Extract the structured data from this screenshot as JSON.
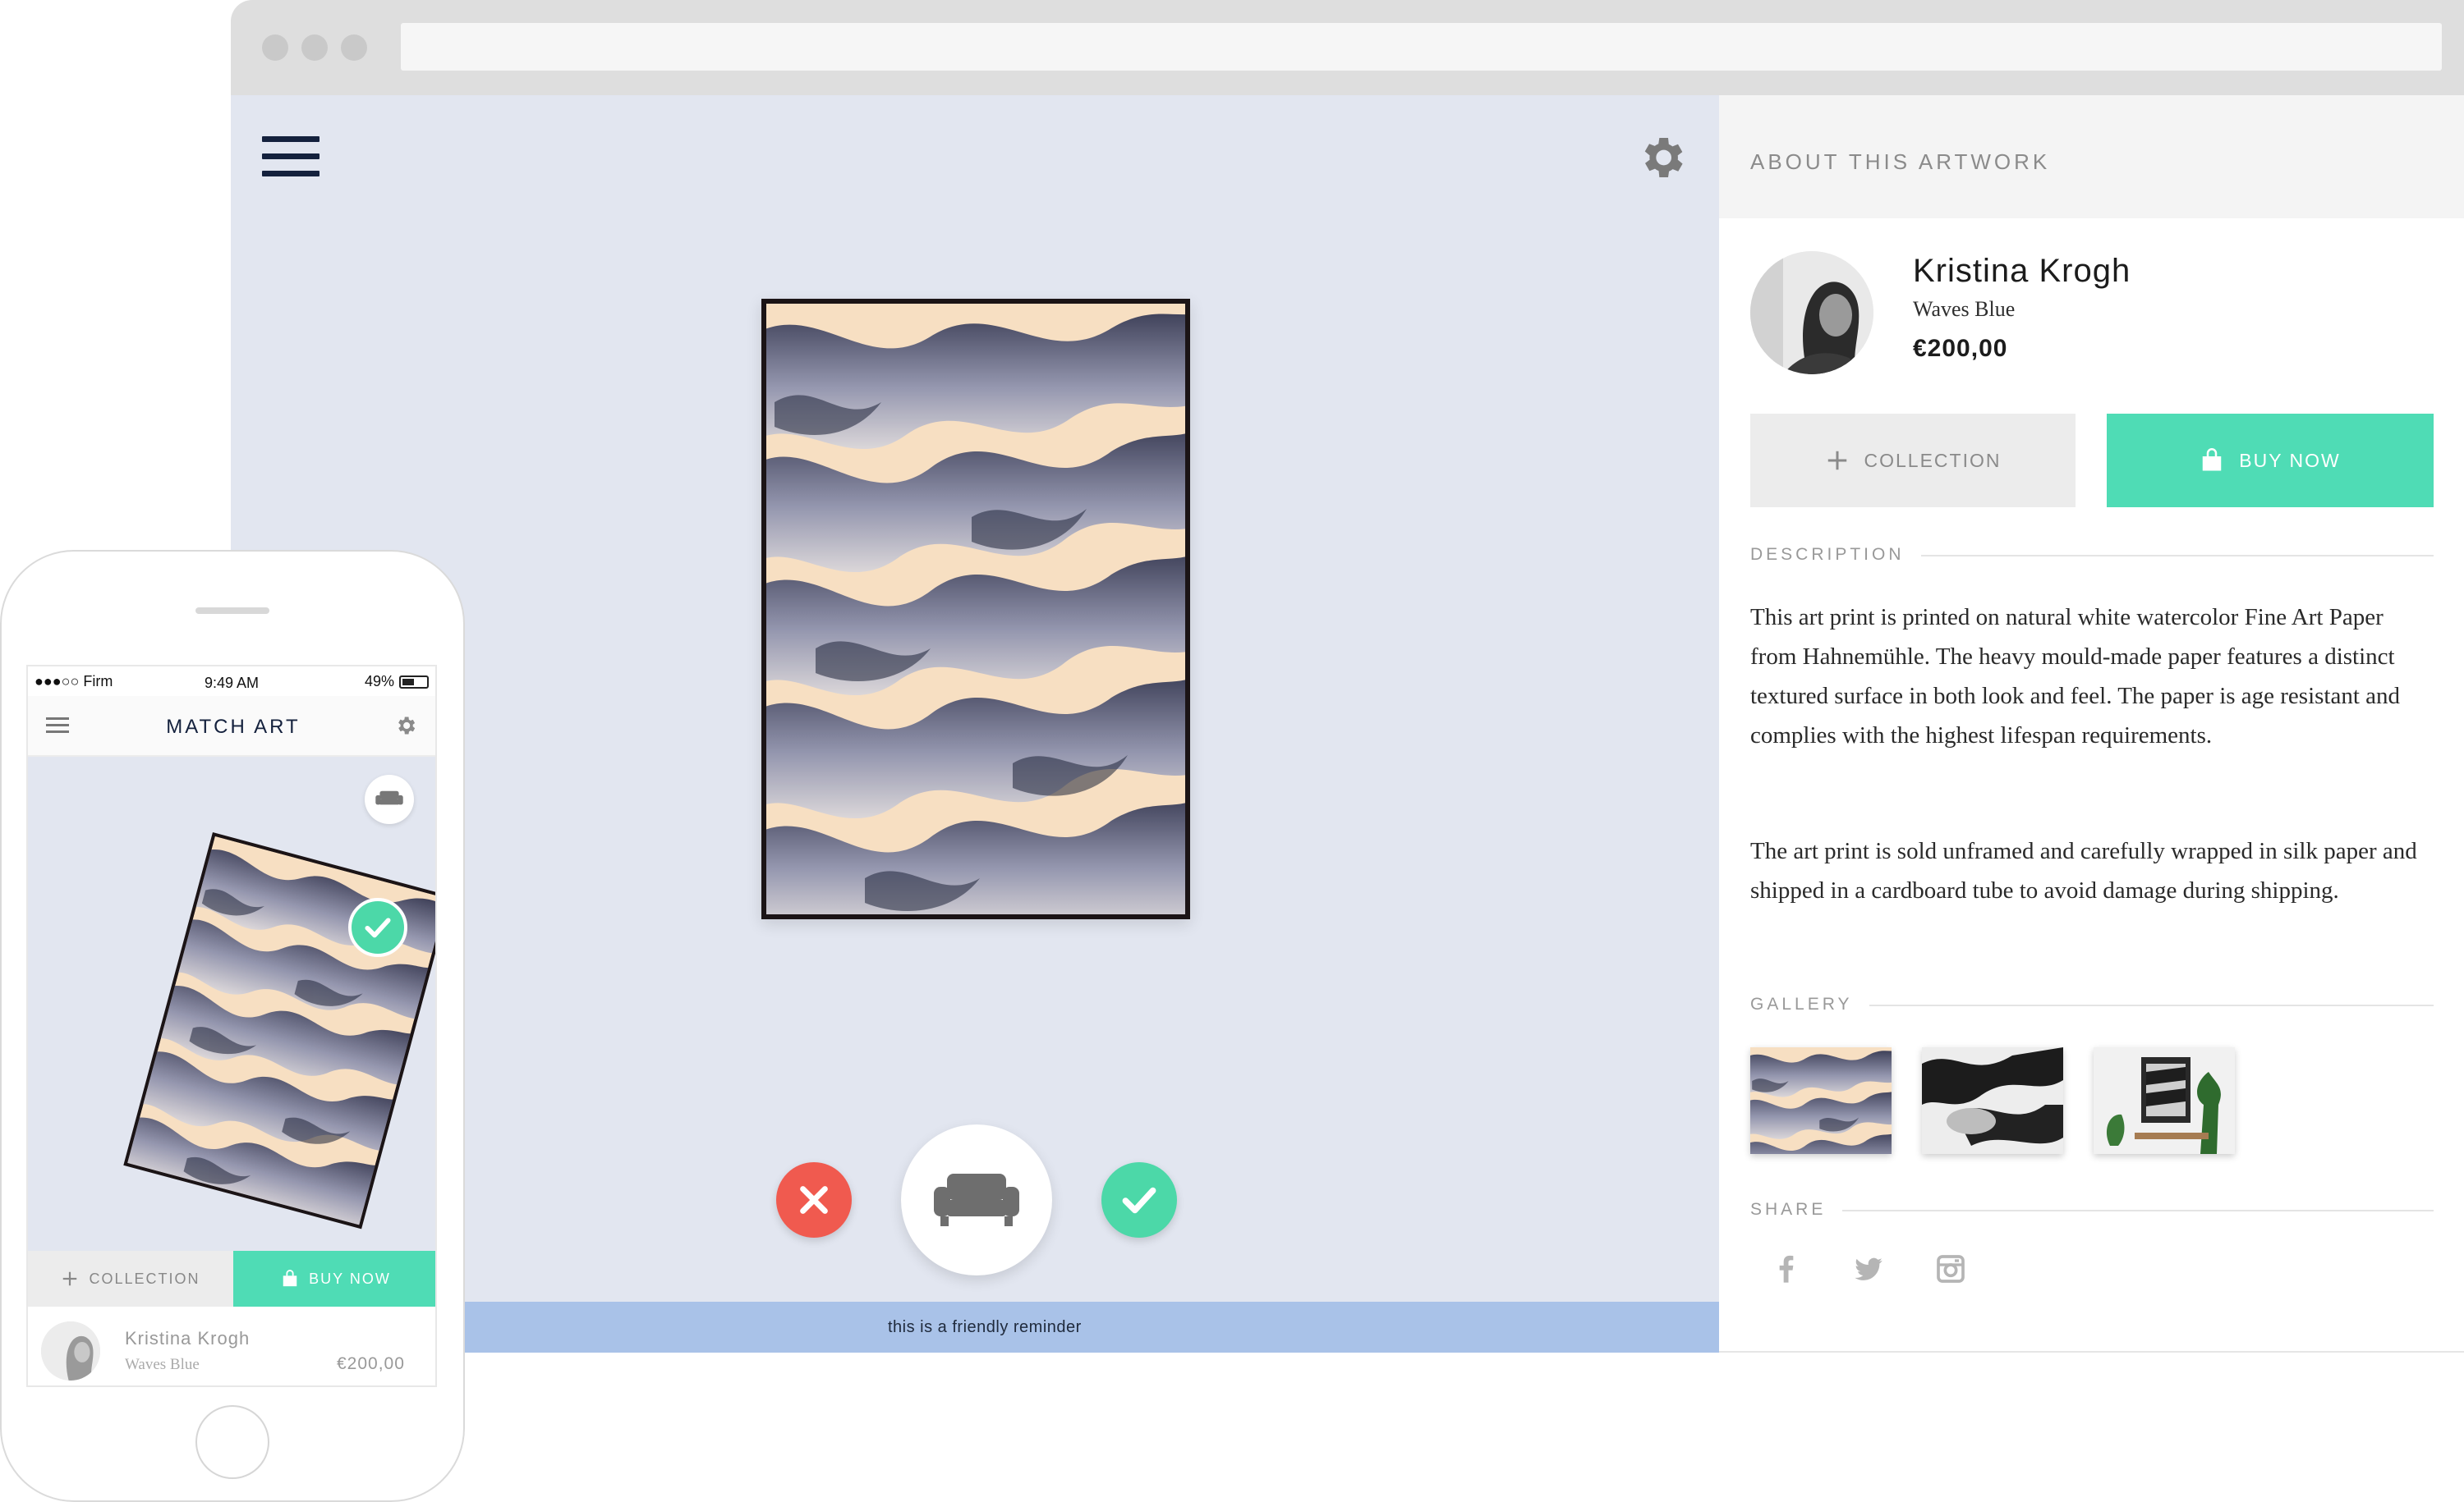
{
  "stage": {
    "reminder": "this is a friendly reminder"
  },
  "panel": {
    "header": "ABOUT THIS ARTWORK",
    "artist": "Kristina Krogh",
    "artwork_title": "Waves Blue",
    "price": "€200,00",
    "collection_label": "COLLECTION",
    "buy_label": "BUY NOW",
    "description_label": "DESCRIPTION",
    "description": [
      "This art print is printed on natural white watercolor Fine Art Paper from Hahnemühle. The heavy mould-made paper features a distinct textured surface in both look and feel. The paper is age resistant and complies with the highest lifespan requirements.",
      "The art print is sold unframed and carefully wrapped in silk paper and shipped in a cardboard tube to avoid damage during shipping."
    ],
    "gallery_label": "GALLERY",
    "share_label": "SHARE",
    "share_icons": [
      "facebook-icon",
      "twitter-icon",
      "instagram-icon"
    ]
  },
  "phone": {
    "status": {
      "carrier": "●●●○○ Firm",
      "time": "9:49 AM",
      "battery": "49%"
    },
    "title": "MATCH ART",
    "collection_label": "COLLECTION",
    "buy_label": "BUY NOW",
    "artist": "Kristina Krogh",
    "artwork_title": "Waves Blue",
    "price": "€200,00"
  },
  "colors": {
    "accent_green": "#4fdcb5",
    "reject_red": "#f05a4f",
    "stage_bg": "#e2e6f0",
    "reminder_bg": "#a9c2e8",
    "navy": "#14213d"
  }
}
